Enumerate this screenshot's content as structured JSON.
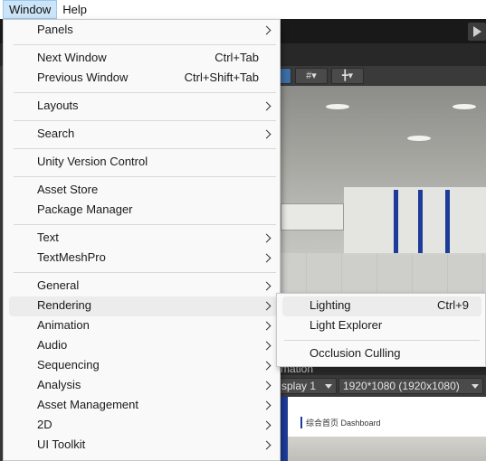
{
  "menubar": {
    "window_label": "Window",
    "help_label": "Help"
  },
  "window_menu": {
    "panels": "Panels",
    "next_window": "Next Window",
    "next_window_shortcut": "Ctrl+Tab",
    "previous_window": "Previous Window",
    "previous_window_shortcut": "Ctrl+Shift+Tab",
    "layouts": "Layouts",
    "search": "Search",
    "unity_version_control": "Unity Version Control",
    "asset_store": "Asset Store",
    "package_manager": "Package Manager",
    "text": "Text",
    "textmeshpro": "TextMeshPro",
    "general": "General",
    "rendering": "Rendering",
    "animation": "Animation",
    "audio": "Audio",
    "sequencing": "Sequencing",
    "analysis": "Analysis",
    "asset_management": "Asset Management",
    "two_d": "2D",
    "ui_toolkit": "UI Toolkit"
  },
  "rendering_submenu": {
    "lighting": "Lighting",
    "lighting_shortcut": "Ctrl+9",
    "light_explorer": "Light Explorer",
    "occlusion_culling": "Occlusion Culling"
  },
  "background": {
    "animation_tab_partial": "mation",
    "display_partial": "splay 1",
    "resolution": "1920*1080 (1920x1080)",
    "game_dashboard_text": "综合首页 Dashboard"
  },
  "colors": {
    "menu_bg": "#f9f9f9",
    "highlight": "#ececec",
    "menubar_active": "#cce4f7",
    "editor_dark": "#383838"
  }
}
